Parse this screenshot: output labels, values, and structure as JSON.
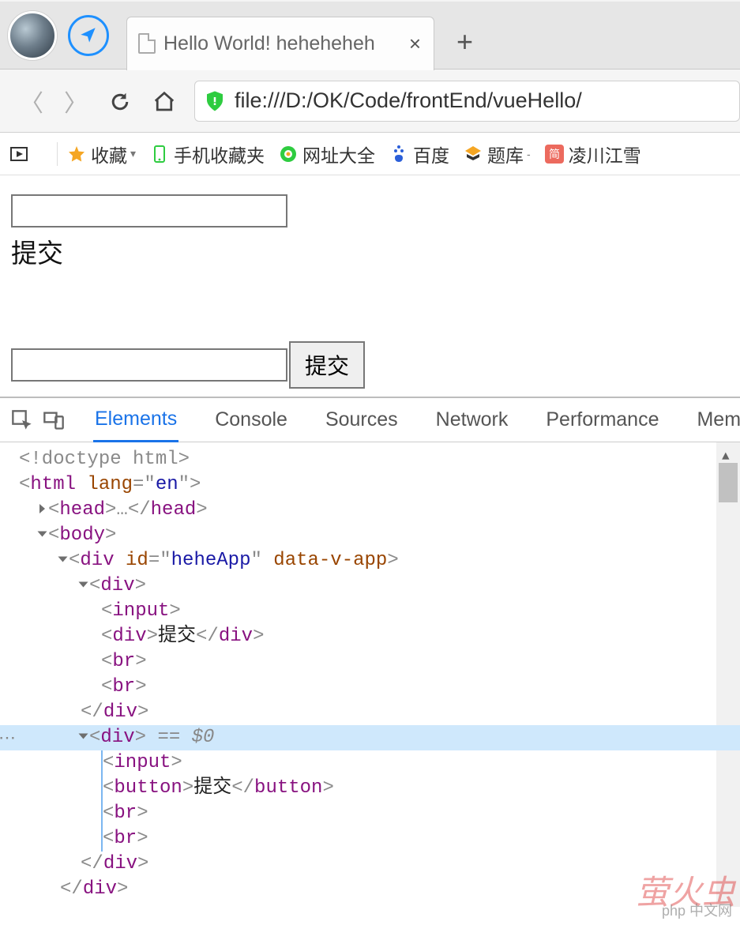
{
  "browser": {
    "tab_title": "Hello World! heheheheh",
    "url": "file:///D:/OK/Code/frontEnd/vueHello/"
  },
  "bookmarks": {
    "fav": "收藏",
    "mobile": "手机收藏夹",
    "sitenav": "网址大全",
    "baidu": "百度",
    "tiku": "题库",
    "lingchuan": "凌川江雪"
  },
  "page": {
    "input1_value": "",
    "submit_label_1": "提交",
    "input2_value": "",
    "submit_button_2": "提交"
  },
  "devtools": {
    "tabs": {
      "elements": "Elements",
      "console": "Console",
      "sources": "Sources",
      "network": "Network",
      "performance": "Performance",
      "memory": "Mem"
    },
    "src": {
      "doctype": "<!doctype html>",
      "html_open": {
        "tag": "html",
        "attr": "lang",
        "val": "en"
      },
      "head": {
        "tag": "head",
        "ell": "…"
      },
      "body": {
        "tag": "body"
      },
      "app": {
        "tag": "div",
        "id_attr": "id",
        "id_val": "heheApp",
        "extra_attr": "data-v-app"
      },
      "div": "div",
      "input": "input",
      "first_text": "提交",
      "br": "br",
      "selected_marker": "== $0",
      "button_tag": "button",
      "button_text": "提交"
    }
  },
  "watermark": {
    "text1": "萤火虫",
    "text2": "php 中文网"
  }
}
